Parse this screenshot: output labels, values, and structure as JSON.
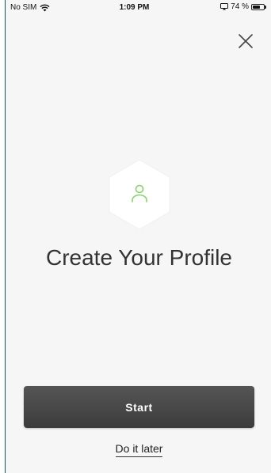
{
  "status_bar": {
    "carrier": "No SIM",
    "time": "1:09 PM",
    "battery_text": "74 %",
    "battery_level": 0.74,
    "wifi_icon": "wifi-icon",
    "screen_mirror_icon": "screen-mirror-icon"
  },
  "header": {
    "close_icon": "close-icon"
  },
  "hero": {
    "icon": "user-icon",
    "icon_color": "#86d46a",
    "title": "Create Your Profile"
  },
  "actions": {
    "start_label": "Start",
    "later_label": "Do it later"
  },
  "colors": {
    "background": "#f7f6f6",
    "button": "#474747",
    "text": "#333333"
  }
}
